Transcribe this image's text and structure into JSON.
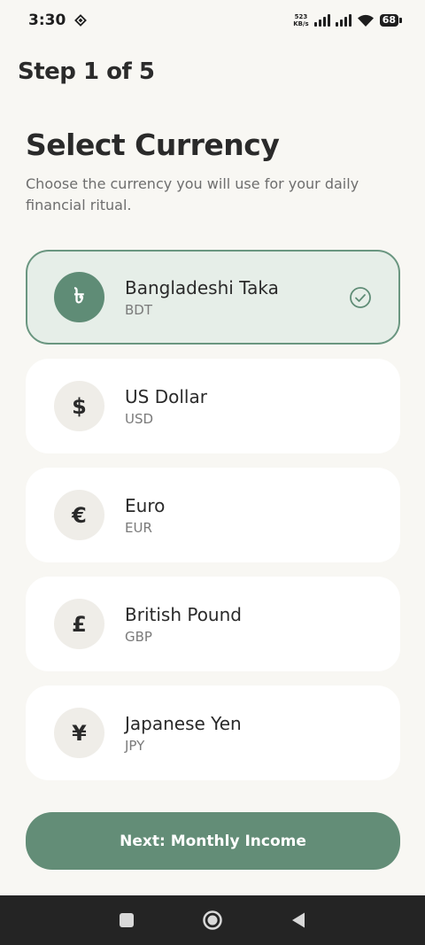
{
  "status_bar": {
    "time": "3:30",
    "net_speed_value": "523",
    "net_speed_unit": "KB/s",
    "battery": "68"
  },
  "header": {
    "step": "Step 1 of 5",
    "title": "Select Currency",
    "subtitle": "Choose the currency you will use for your daily financial ritual."
  },
  "currencies": [
    {
      "symbol": "৳",
      "name": "Bangladeshi Taka",
      "code": "BDT",
      "selected": true
    },
    {
      "symbol": "$",
      "name": "US Dollar",
      "code": "USD",
      "selected": false
    },
    {
      "symbol": "€",
      "name": "Euro",
      "code": "EUR",
      "selected": false
    },
    {
      "symbol": "£",
      "name": "British Pound",
      "code": "GBP",
      "selected": false
    },
    {
      "symbol": "¥",
      "name": "Japanese Yen",
      "code": "JPY",
      "selected": false
    }
  ],
  "footer": {
    "next_label": "Next: Monthly Income"
  },
  "colors": {
    "accent": "#638d77",
    "selected_bg": "#e6eee8",
    "background": "#f8f7f3"
  },
  "icons": {
    "selected_check": "check-circle-icon",
    "nav_recents": "square-icon",
    "nav_home": "circle-icon",
    "nav_back": "triangle-back-icon"
  }
}
